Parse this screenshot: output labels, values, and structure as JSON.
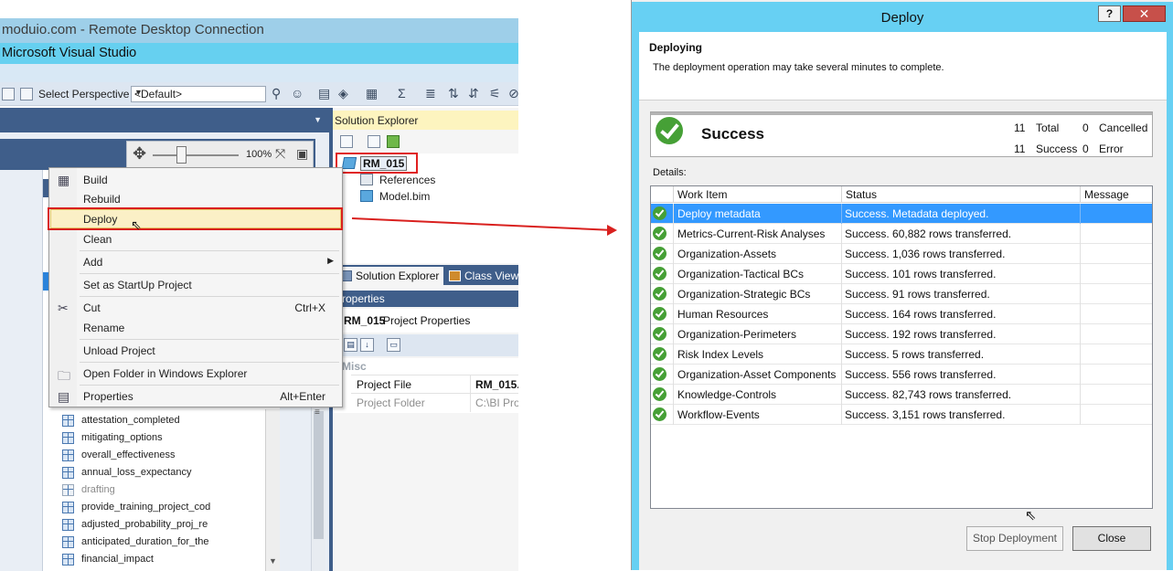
{
  "vs": {
    "rdp_title": "moduio.com - Remote Desktop Connection",
    "app_title": "Microsoft Visual Studio",
    "toolbar": {
      "perspective_label": "Select Perspective",
      "perspective_value": "<Default>"
    },
    "zoom": "100%",
    "context_menu": {
      "items": [
        {
          "label": "Build"
        },
        {
          "label": "Rebuild"
        },
        {
          "label": "Deploy"
        },
        {
          "label": "Clean"
        },
        {
          "label": "Add"
        },
        {
          "label": "Set as StartUp Project"
        },
        {
          "label": "Cut",
          "shortcut": "Ctrl+X"
        },
        {
          "label": "Rename"
        },
        {
          "label": "Unload Project"
        },
        {
          "label": "Open Folder in Windows Explorer"
        },
        {
          "label": "Properties",
          "shortcut": "Alt+Enter"
        }
      ]
    },
    "columns": [
      "attestation_completed",
      "mitigating_options",
      "overall_effectiveness",
      "annual_loss_expectancy",
      "drafting",
      "provide_training_project_cod",
      "adjusted_probability_proj_re",
      "anticipated_duration_for_the",
      "financial_impact"
    ],
    "solution_explorer": {
      "title": "Solution Explorer",
      "project": "RM_015",
      "nodes": [
        "References",
        "Model.bim"
      ],
      "tab_se": "Solution Explorer",
      "tab_cv": "Class View"
    },
    "properties": {
      "title": "roperties",
      "object_name": "RM_015",
      "object_type": "Project Properties",
      "category": "Misc",
      "rows": [
        {
          "key": "Project File",
          "value": "RM_015."
        },
        {
          "key": "Project Folder",
          "value": "C:\\BI Pro"
        }
      ]
    }
  },
  "dialog": {
    "title": "Deploy",
    "help_btn": "?",
    "close_btn": "✕",
    "heading": "Deploying",
    "subtext": "The deployment operation may take several minutes to complete.",
    "summary": {
      "status": "Success",
      "total_count": "11",
      "total_label": "Total",
      "success_count": "11",
      "success_label": "Success",
      "cancelled_count": "0",
      "cancelled_label": "Cancelled",
      "error_count": "0",
      "error_label": "Error"
    },
    "details_label": "Details:",
    "columns": [
      "Work Item",
      "Status",
      "Message"
    ],
    "rows": [
      {
        "item": "Deploy metadata",
        "status": "Success. Metadata deployed.",
        "message": ""
      },
      {
        "item": "Metrics-Current-Risk Analyses",
        "status": "Success. 60,882 rows transferred.",
        "message": ""
      },
      {
        "item": "Organization-Assets",
        "status": "Success. 1,036 rows transferred.",
        "message": ""
      },
      {
        "item": "Organization-Tactical BCs",
        "status": "Success. 101 rows transferred.",
        "message": ""
      },
      {
        "item": "Organization-Strategic BCs",
        "status": "Success. 91 rows transferred.",
        "message": ""
      },
      {
        "item": "Human Resources",
        "status": "Success. 164 rows transferred.",
        "message": ""
      },
      {
        "item": "Organization-Perimeters",
        "status": "Success. 192 rows transferred.",
        "message": ""
      },
      {
        "item": "Risk Index Levels",
        "status": "Success. 5 rows transferred.",
        "message": ""
      },
      {
        "item": "Organization-Asset Components",
        "status": "Success. 556 rows transferred.",
        "message": ""
      },
      {
        "item": "Knowledge-Controls",
        "status": "Success. 82,743 rows transferred.",
        "message": ""
      },
      {
        "item": "Workflow-Events",
        "status": "Success. 3,151 rows transferred.",
        "message": ""
      }
    ],
    "buttons": {
      "stop": "Stop Deployment",
      "close": "Close"
    }
  },
  "colors": {
    "accent_title": "#67d0f3",
    "success_green": "#46a036",
    "selection_blue": "#3399ff",
    "highlight_red": "#d9201e"
  }
}
